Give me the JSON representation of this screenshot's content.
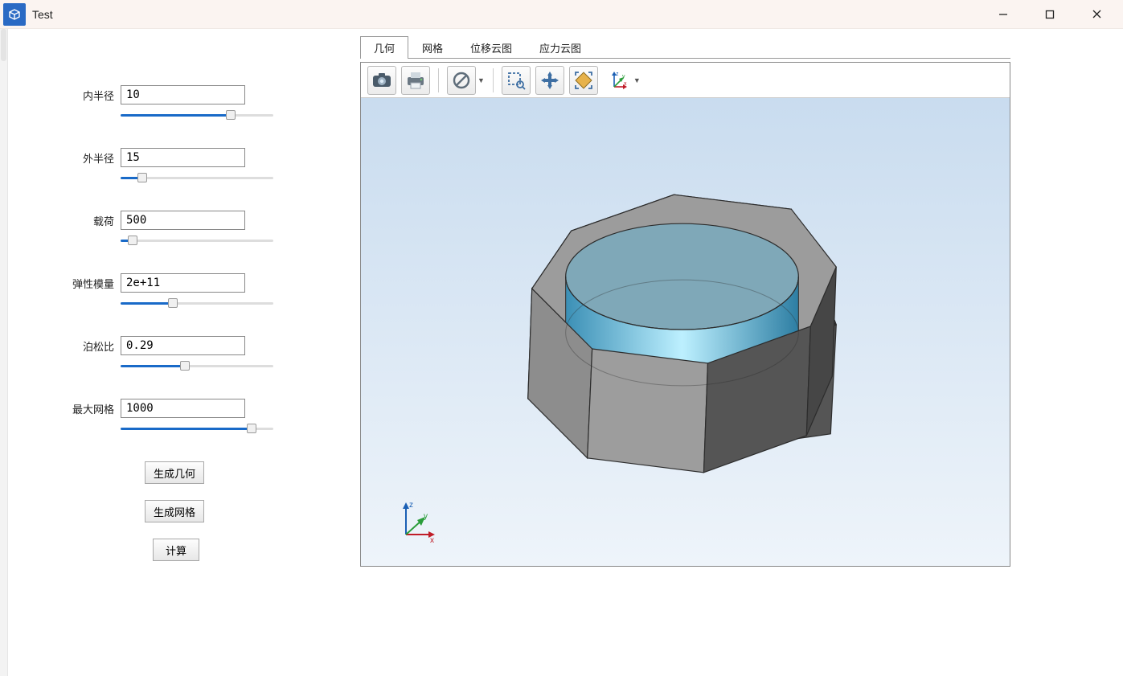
{
  "window": {
    "title": "Test"
  },
  "sidebar": {
    "params": [
      {
        "label": "内半径",
        "value": "10",
        "fill_pct": 72
      },
      {
        "label": "外半径",
        "value": "15",
        "fill_pct": 14
      },
      {
        "label": "载荷",
        "value": "500",
        "fill_pct": 8
      },
      {
        "label": "弹性模量",
        "value": "2e+11",
        "fill_pct": 34
      },
      {
        "label": "泊松比",
        "value": "0.29",
        "fill_pct": 42
      },
      {
        "label": "最大网格",
        "value": "1000",
        "fill_pct": 86
      }
    ],
    "buttons": {
      "geom": "生成几何",
      "mesh": "生成网格",
      "compute": "计算"
    }
  },
  "tabs": {
    "items": [
      "几何",
      "网格",
      "位移云图",
      "应力云图"
    ],
    "active": 0
  },
  "toolbar": {
    "screenshot": "screenshot-icon",
    "print": "print-icon",
    "forbid": "forbid-icon",
    "zoom_select": "zoom-select-icon",
    "pan": "pan-icon",
    "fit": "fit-icon",
    "axes": "axes-icon"
  },
  "triad": {
    "x": "x",
    "y": "y",
    "z": "z"
  }
}
